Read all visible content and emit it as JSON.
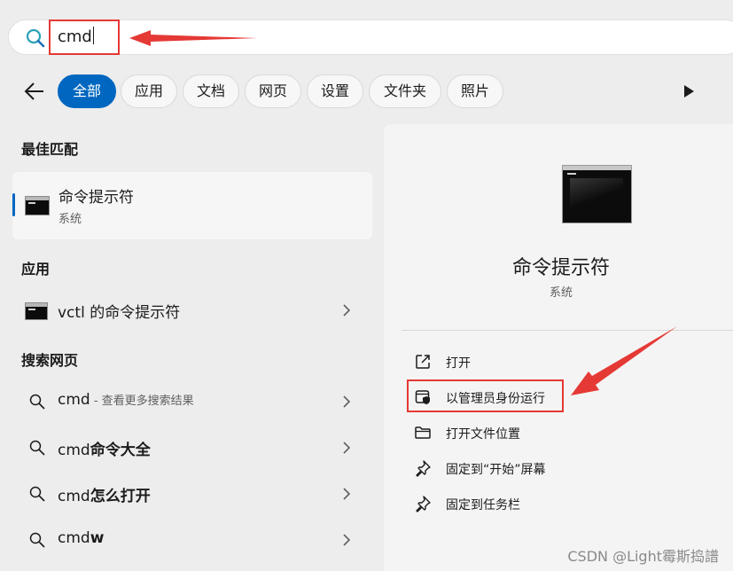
{
  "search": {
    "query": "cmd"
  },
  "filters": [
    {
      "label": "全部",
      "active": true
    },
    {
      "label": "应用"
    },
    {
      "label": "文档"
    },
    {
      "label": "网页"
    },
    {
      "label": "设置"
    },
    {
      "label": "文件夹"
    },
    {
      "label": "照片"
    }
  ],
  "sections": {
    "best_match": "最佳匹配",
    "apps": "应用",
    "web": "搜索网页"
  },
  "best_match": {
    "title": "命令提示符",
    "subtitle": "系统"
  },
  "apps": [
    {
      "title": "vctl 的命令提示符"
    }
  ],
  "web_results": [
    {
      "prefix": "cmd",
      "suffix": " - 查看更多搜索结果"
    },
    {
      "prefix": "cmd",
      "bold": "命令大全"
    },
    {
      "prefix": "cmd",
      "bold": "怎么打开"
    },
    {
      "prefix": "cmd",
      "bold": "w"
    }
  ],
  "detail": {
    "title": "命令提示符",
    "subtitle": "系统",
    "actions": [
      {
        "label": "打开",
        "icon": "open-external-icon"
      },
      {
        "label": "以管理员身份运行",
        "icon": "run-as-admin-shield-icon"
      },
      {
        "label": "打开文件位置",
        "icon": "folder-icon"
      },
      {
        "label": "固定到“开始”屏幕",
        "icon": "pin-icon"
      },
      {
        "label": "固定到任务栏",
        "icon": "pin-icon"
      }
    ]
  },
  "watermark": "CSDN @Light霉斯捣譜",
  "colors": {
    "accent": "#0067c0",
    "annotation": "#e53935"
  }
}
